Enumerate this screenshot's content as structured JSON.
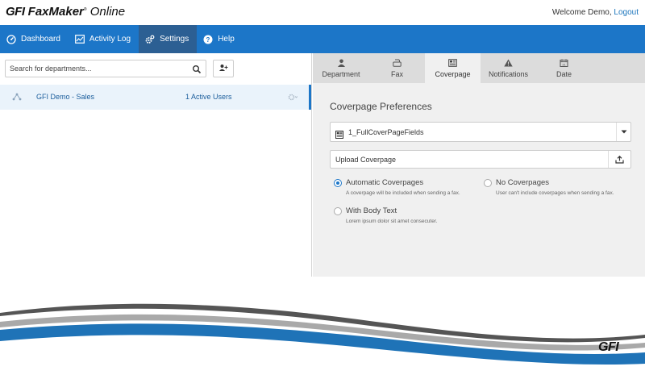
{
  "header": {
    "logo_gfi": "GFI",
    "logo_faxmaker": "FaxMaker",
    "logo_online": "Online",
    "welcome_text": "Welcome Demo,",
    "logout_label": "Logout"
  },
  "nav": {
    "items": [
      {
        "label": "Dashboard",
        "icon": "dashboard-icon"
      },
      {
        "label": "Activity Log",
        "icon": "activity-log-icon"
      },
      {
        "label": "Settings",
        "icon": "settings-gear-icon",
        "active": true
      },
      {
        "label": "Help",
        "icon": "help-icon"
      }
    ]
  },
  "left_panel": {
    "search_placeholder": "Search for departments...",
    "departments": [
      {
        "name": "GFI Demo - Sales",
        "users": "1 Active Users",
        "selected": true
      }
    ]
  },
  "tabs": [
    {
      "label": "Department",
      "icon": "user-icon"
    },
    {
      "label": "Fax",
      "icon": "fax-icon"
    },
    {
      "label": "Coverpage",
      "icon": "coverpage-icon",
      "active": true
    },
    {
      "label": "Notifications",
      "icon": "warning-icon"
    },
    {
      "label": "Date",
      "icon": "calendar-icon"
    }
  ],
  "coverpage": {
    "title": "Coverpage Preferences",
    "selected_template": "1_FullCoverPageFields",
    "upload_label": "Upload Coverpage",
    "options": [
      {
        "label": "Automatic Coverpages",
        "desc": "A coverpage will be included when sending a fax.",
        "checked": true
      },
      {
        "label": "No Coverpages",
        "desc": "User can't include coverpages when sending a fax.",
        "checked": false
      },
      {
        "label": "With Body Text",
        "desc": "Lorem ipsum dolor sit amet consecuter.",
        "checked": false
      }
    ]
  },
  "footer": {
    "brand": "GFI"
  },
  "colors": {
    "primary": "#1c76c8",
    "nav_active": "#2c5f93",
    "panel_bg": "#f0f0f0",
    "tab_bar_bg": "#dcdcdc",
    "swoosh_blue": "#1f73b7",
    "swoosh_gray": "#8f8f8f"
  }
}
